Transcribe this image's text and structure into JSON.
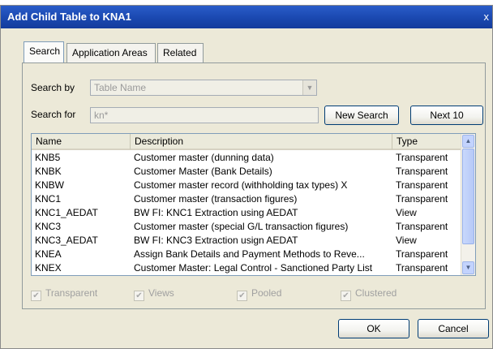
{
  "window": {
    "title": "Add Child Table to KNA1",
    "close_glyph": "x"
  },
  "tabs": [
    {
      "label": "Search",
      "active": true
    },
    {
      "label": "Application Areas",
      "active": false
    },
    {
      "label": "Related",
      "active": false
    }
  ],
  "search": {
    "by_label": "Search by",
    "by_value": "Table Name",
    "for_label": "Search for",
    "for_value": "kn*",
    "new_search_label": "New Search",
    "next_label": "Next 10"
  },
  "table": {
    "columns": [
      "Name",
      "Description",
      "Type"
    ],
    "rows": [
      {
        "name": "KNB5",
        "description": "Customer master (dunning data)",
        "type": "Transparent"
      },
      {
        "name": "KNBK",
        "description": "Customer Master (Bank Details)",
        "type": "Transparent"
      },
      {
        "name": "KNBW",
        "description": "Customer master record (withholding tax types) X",
        "type": "Transparent"
      },
      {
        "name": "KNC1",
        "description": "Customer master (transaction figures)",
        "type": "Transparent"
      },
      {
        "name": "KNC1_AEDAT",
        "description": "BW FI: KNC1 Extraction using AEDAT",
        "type": "View"
      },
      {
        "name": "KNC3",
        "description": "Customer master (special G/L transaction figures)",
        "type": "Transparent"
      },
      {
        "name": "KNC3_AEDAT",
        "description": "BW FI: KNC3 Extraction usign AEDAT",
        "type": "View"
      },
      {
        "name": "KNEA",
        "description": "Assign Bank Details and Payment Methods to Reve...",
        "type": "Transparent"
      },
      {
        "name": "KNEX",
        "description": "Customer Master: Legal Control - Sanctioned Party List",
        "type": "Transparent"
      }
    ]
  },
  "filters": [
    {
      "label": "Transparent",
      "checked": true
    },
    {
      "label": "Views",
      "checked": true
    },
    {
      "label": "Pooled",
      "checked": true
    },
    {
      "label": "Clustered",
      "checked": true
    }
  ],
  "footer": {
    "ok_label": "OK",
    "cancel_label": "Cancel"
  },
  "icons": {
    "scroll_up": "up-arrow-icon",
    "scroll_down": "down-arrow-icon",
    "dropdown": "chevron-down-icon"
  },
  "colors": {
    "title_bar": "#1a48b0",
    "selection_border": "#7f9db9"
  }
}
